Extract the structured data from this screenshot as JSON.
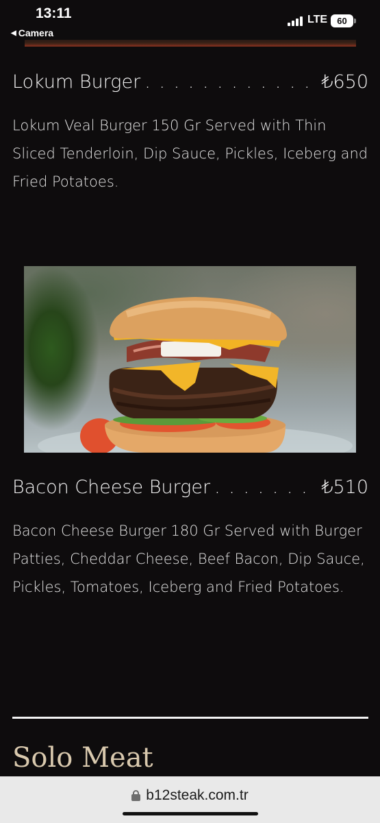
{
  "status_bar": {
    "time": "13:11",
    "back_label": "Camera",
    "network": "LTE",
    "battery": "60"
  },
  "menu": {
    "items": [
      {
        "name": "Lokum Burger",
        "price": "₺650",
        "description": "Lokum Veal Burger 150 Gr Served with Thin Sliced Tenderloin, Dip Sauce, Pickles, Iceberg and Fried Potatoes."
      },
      {
        "name": "Bacon Cheese Burger",
        "price": "₺510",
        "description": "Bacon Cheese Burger 180 Gr Served with Burger Patties, Cheddar Cheese, Beef Bacon, Dip Sauce, Pickles, Tomatoes, Iceberg and Fried Potatoes."
      }
    ],
    "next_section": "Solo Meat"
  },
  "browser": {
    "url": "b12steak.com.tr"
  },
  "colors": {
    "background": "#0e0c0d",
    "text": "#f2f2f2",
    "section_title": "#d9c9ae",
    "url_bar": "#e9e9e9"
  }
}
